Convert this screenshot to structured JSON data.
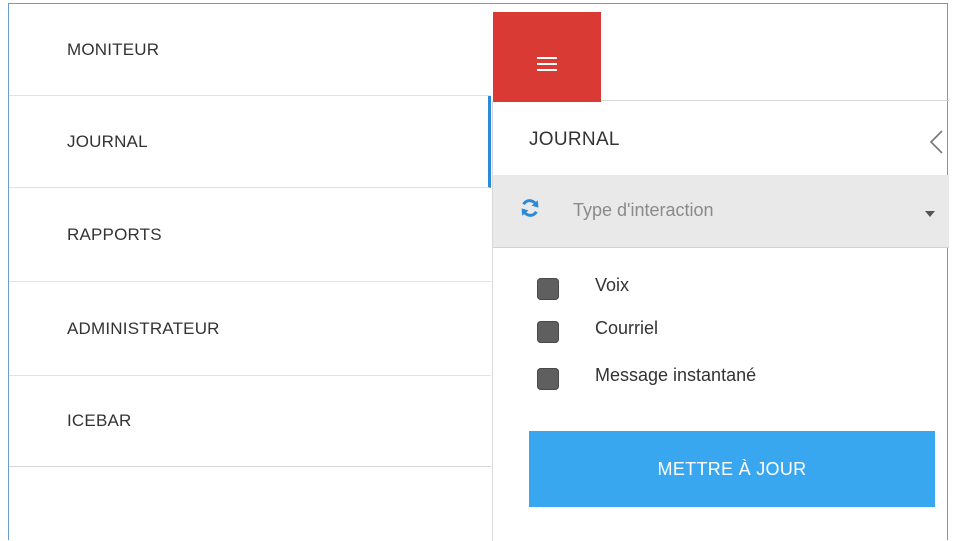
{
  "nav": {
    "items": [
      {
        "label": "MONITEUR"
      },
      {
        "label": "JOURNAL"
      },
      {
        "label": "RAPPORTS"
      },
      {
        "label": "ADMINISTRATEUR"
      },
      {
        "label": "ICEBAR"
      }
    ],
    "active": "JOURNAL"
  },
  "panel": {
    "title": "JOURNAL",
    "filter": {
      "placeholder": "Type d'interaction",
      "icon": "refresh-icon"
    },
    "options": [
      {
        "label": "Voix",
        "checked": false
      },
      {
        "label": "Courriel",
        "checked": false
      },
      {
        "label": "Message instantané",
        "checked": false
      }
    ],
    "update_button": "METTRE À JOUR"
  },
  "colors": {
    "hamburger_bg": "#d93a33",
    "accent": "#39a7f0",
    "active_indicator": "#2b8ad8",
    "filter_bg": "#e9e9e9"
  }
}
